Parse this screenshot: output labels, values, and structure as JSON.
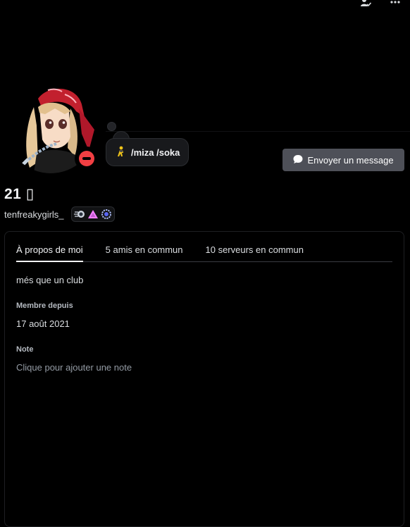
{
  "header": {
    "icons": [
      "add-friend-check-icon",
      "more-options-icon"
    ]
  },
  "profile": {
    "display_name": "21 ▯",
    "username": "tenfreakygirls_",
    "status": "do-not-disturb",
    "custom_status": {
      "emoji": "walking-person-emoji",
      "text": "/miza /soka"
    },
    "badges": [
      "nitro-speed-badge",
      "hypesquad-brilliance-badge",
      "server-boost-badge"
    ]
  },
  "actions": {
    "message_button_label": "Envoyer un message"
  },
  "tabs": [
    {
      "label": "À propos de moi",
      "active": true
    },
    {
      "label": "5 amis en commun",
      "active": false
    },
    {
      "label": "10 serveurs en commun",
      "active": false
    }
  ],
  "about": {
    "bio": "més que un club",
    "member_since_label": "Membre depuis",
    "member_since_value": "17 août 2021",
    "note_label": "Note",
    "note_placeholder": "Clique pour ajouter une note"
  },
  "colors": {
    "background": "#000000",
    "dnd_red": "#f23f43",
    "button_gray": "#4e5058",
    "text_primary": "#f2f3f5",
    "text_secondary": "#dbdee1",
    "text_muted": "#949ba4"
  }
}
